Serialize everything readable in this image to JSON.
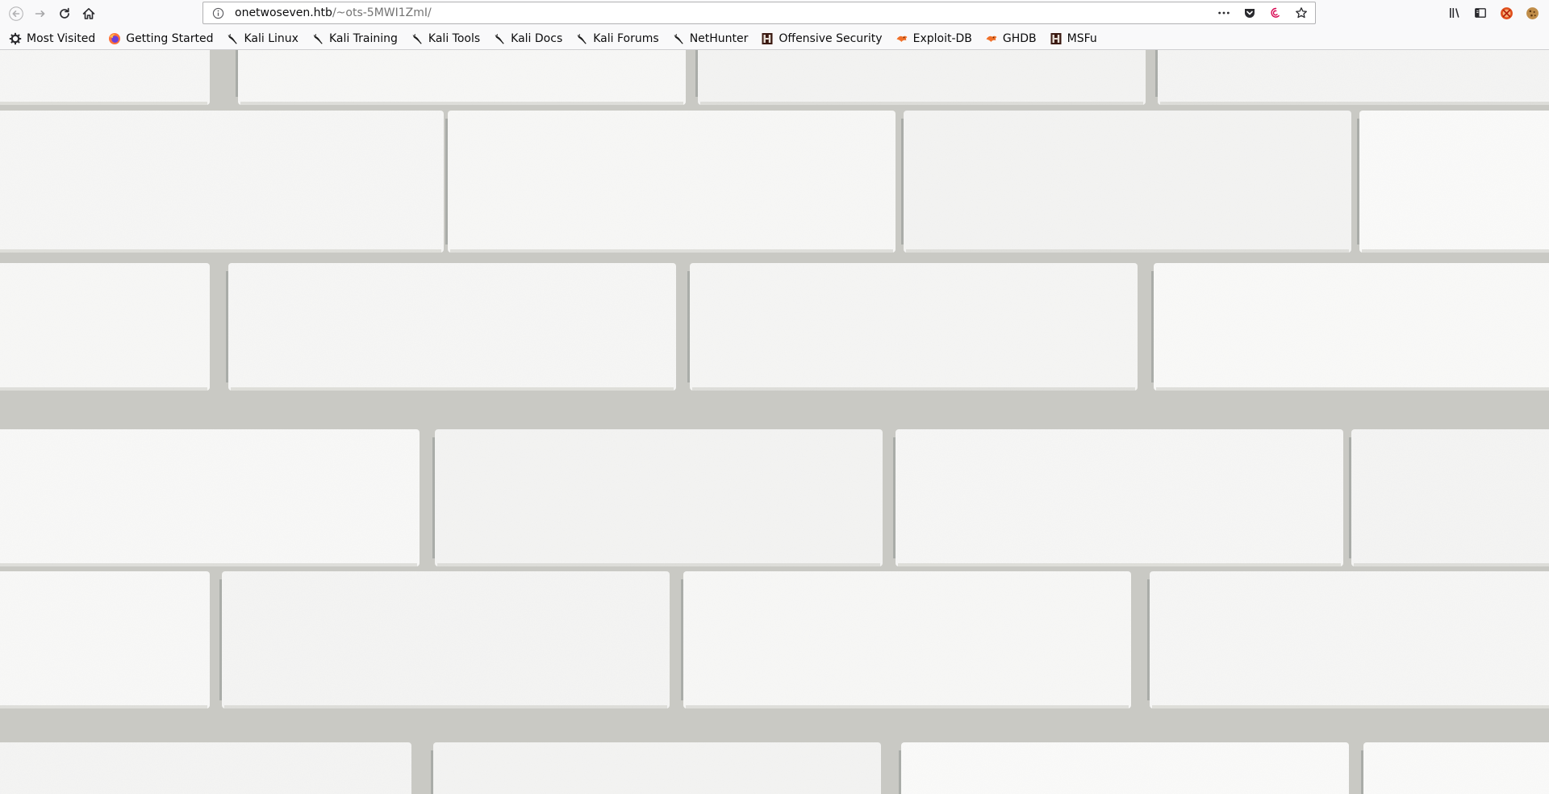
{
  "url": {
    "host": "onetwoseven.htb",
    "path": "/~ots-5MWI1ZmI/"
  },
  "nav": {
    "back_icon": "back-arrow-icon",
    "forward_icon": "forward-arrow-icon",
    "reload_icon": "reload-icon",
    "home_icon": "home-icon"
  },
  "url_actions": [
    "more-actions-icon",
    "pocket-icon",
    "debian-icon",
    "bookmark-star-icon"
  ],
  "toolbar_right": [
    "library-icon",
    "sidebar-icon",
    "noscript-icon",
    "cookie-icon"
  ],
  "bookmarks": [
    {
      "label": "Most Visited",
      "icon": "gear-icon"
    },
    {
      "label": "Getting Started",
      "icon": "firefox-icon"
    },
    {
      "label": "Kali Linux",
      "icon": "kali-dragon-icon"
    },
    {
      "label": "Kali Training",
      "icon": "kali-dragon-icon"
    },
    {
      "label": "Kali Tools",
      "icon": "kali-dragon-icon"
    },
    {
      "label": "Kali Docs",
      "icon": "kali-dragon-icon"
    },
    {
      "label": "Kali Forums",
      "icon": "kali-dragon-icon"
    },
    {
      "label": "NetHunter",
      "icon": "kali-dragon-icon"
    },
    {
      "label": "Offensive Security",
      "icon": "offsec-icon"
    },
    {
      "label": "Exploit-DB",
      "icon": "exploitdb-icon"
    },
    {
      "label": "GHDB",
      "icon": "exploitdb-icon"
    },
    {
      "label": "MSFu",
      "icon": "offsec-icon"
    }
  ],
  "page": {
    "background": "white-brick-wall-image"
  }
}
